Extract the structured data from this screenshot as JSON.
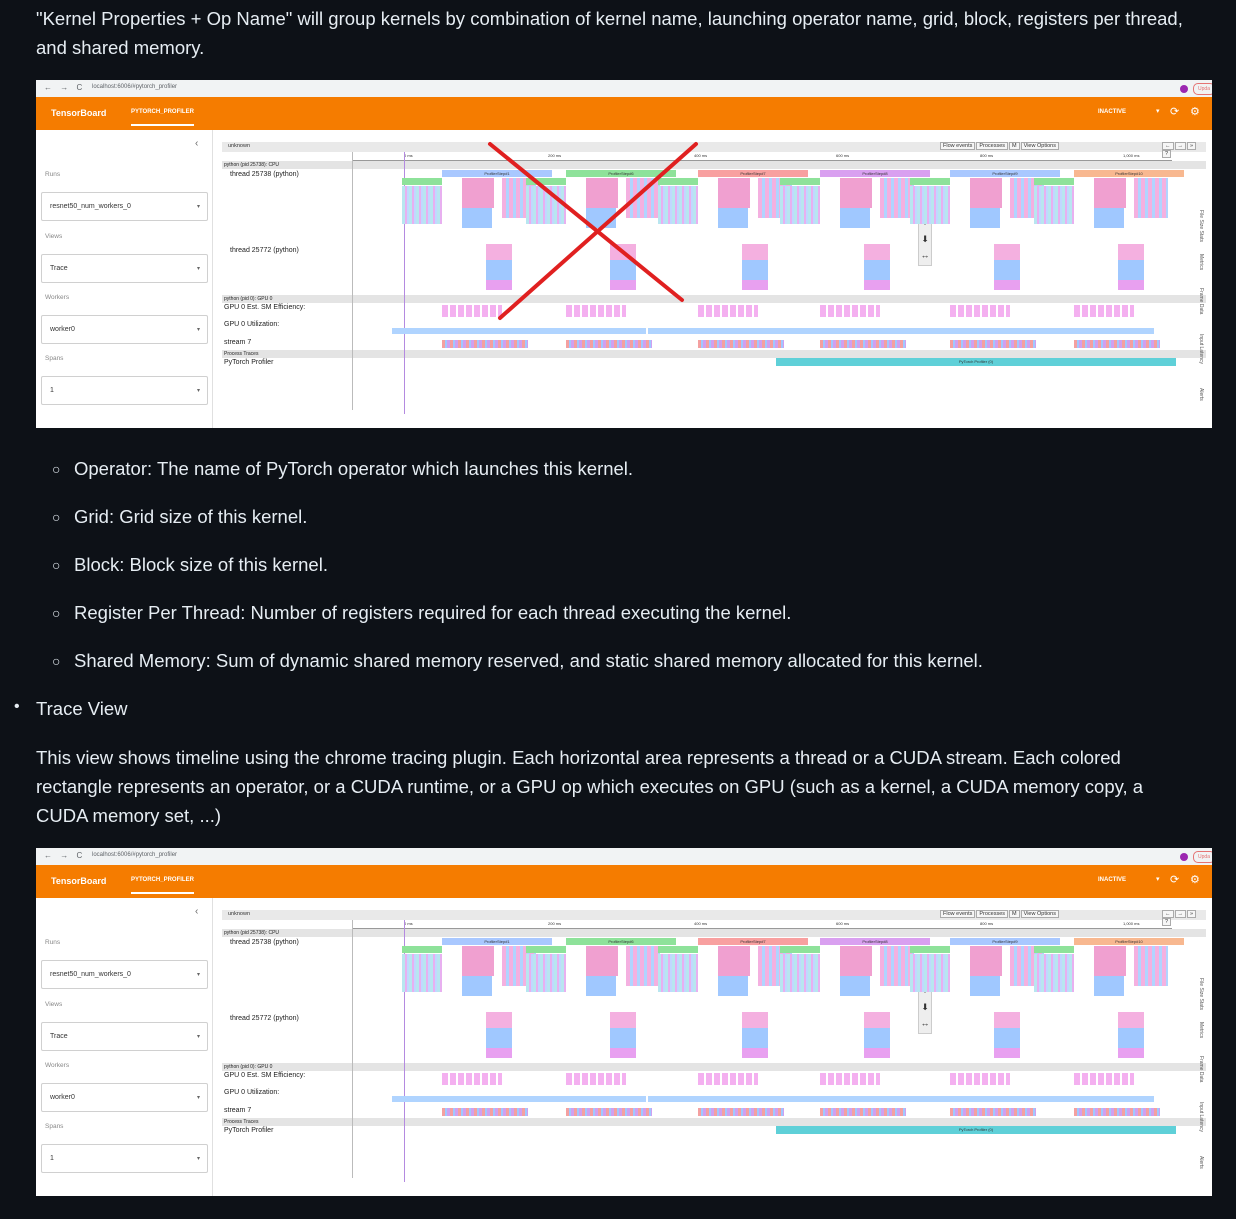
{
  "intro_paragraph": "\"Kernel Properties + Op Name\" will group kernels by combination of kernel name, launching operator name, grid, block, registers per thread, and shared memory.",
  "bullets": [
    "Operator: The name of PyTorch operator which launches this kernel.",
    "Grid: Grid size of this kernel.",
    "Block: Block size of this kernel.",
    "Register Per Thread: Number of registers required for each thread executing the kernel.",
    "Shared Memory: Sum of dynamic shared memory reserved, and static shared memory allocated for this kernel."
  ],
  "trace_view_heading": "Trace View",
  "trace_view_paragraph": "This view shows timeline using the chrome tracing plugin. Each horizontal area represents a thread or a CUDA stream. Each colored rectangle represents an operator, or a CUDA runtime, or a GPU op which executes on GPU (such as a kernel, a CUDA memory copy, a CUDA memory set, ...)",
  "screenshot": {
    "url": "localhost:6006/#pytorch_profiler",
    "brand": "TensorBoard",
    "tab": "PYTORCH_PROFILER",
    "status": "INACTIVE",
    "update_label": "Upda",
    "sidebar": {
      "runs_label": "Runs",
      "runs_value": "resnet50_num_workers_0",
      "views_label": "Views",
      "views_value": "Trace",
      "workers_label": "Workers",
      "workers_value": "worker0",
      "spans_label": "Spans",
      "spans_value": "1"
    },
    "trace": {
      "process_tag": "unknown",
      "buttons": [
        "Flow events",
        "Processes",
        "M",
        "View Options"
      ],
      "nav_buttons": [
        "←",
        "→",
        "»",
        "?"
      ],
      "ruler_ticks": [
        "0 ms",
        "200 ms",
        "400 ms",
        "600 ms",
        "800 ms",
        "1,000 ms"
      ],
      "cpu_process": "python (pid 25738): CPU",
      "thread1": "thread 25738 (python)",
      "thread2": "thread 25772 (python)",
      "gpu_process": "python (pid 0): GPU 0",
      "sm_eff": "GPU 0 Est. SM Efficiency:",
      "util": "GPU 0 Utilization:",
      "stream": "stream 7",
      "process_traces": "Process Traces",
      "profiler_row": "PyTorch Profiler",
      "profiler_bar": "PyTorch Profiler (0)",
      "step_labels": [
        "ProfilerStep#1",
        "ProfilerStep#6",
        "ProfilerStep#7",
        "ProfilerStep#8",
        "ProfilerStep#9",
        "ProfilerStep#10"
      ],
      "enum_label": "enumerate(DataL...",
      "opt_label": "Opt...",
      "o_label": "O...",
      "side_tabs": [
        "File Size Stats",
        "Metrics",
        "Frame Data",
        "Input Latency",
        "Alerts"
      ]
    }
  },
  "colors": {
    "background": "#0d1117",
    "text": "#e6edf3",
    "orange": "#f57c00",
    "cross": "#e02020"
  }
}
